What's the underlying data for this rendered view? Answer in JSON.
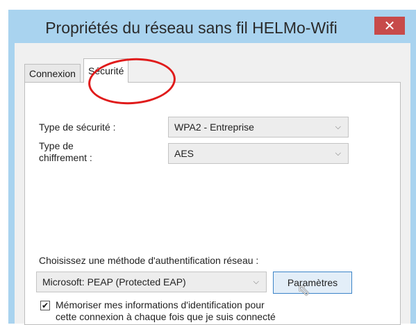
{
  "window": {
    "title": "Propriétés du réseau sans fil HELMo-Wifi",
    "close_label": "✕"
  },
  "tabs": [
    {
      "label": "Connexion"
    },
    {
      "label": "Sécurité"
    }
  ],
  "security": {
    "type_label": "Type de sécurité :",
    "type_value": "WPA2 - Entreprise",
    "cipher_label_line1": "Type de",
    "cipher_label_line2": "chiffrement :",
    "cipher_value": "AES"
  },
  "auth": {
    "method_label": "Choisissez une méthode d'authentification réseau :",
    "method_value": "Microsoft: PEAP (Protected EAP)",
    "settings_button": "Paramètres"
  },
  "remember": {
    "checked": true,
    "line1": "Mémoriser mes informations d'identification pour",
    "line2": "cette connexion à chaque fois que je suis connecté"
  },
  "icons": {
    "chevron": "chevron-down-icon",
    "cursor": "mouse-cursor-icon",
    "check": "checkmark-icon"
  },
  "colors": {
    "window_frame": "#a9d3ef",
    "close_button": "#c74a4a",
    "annotation": "#e01b1b"
  }
}
